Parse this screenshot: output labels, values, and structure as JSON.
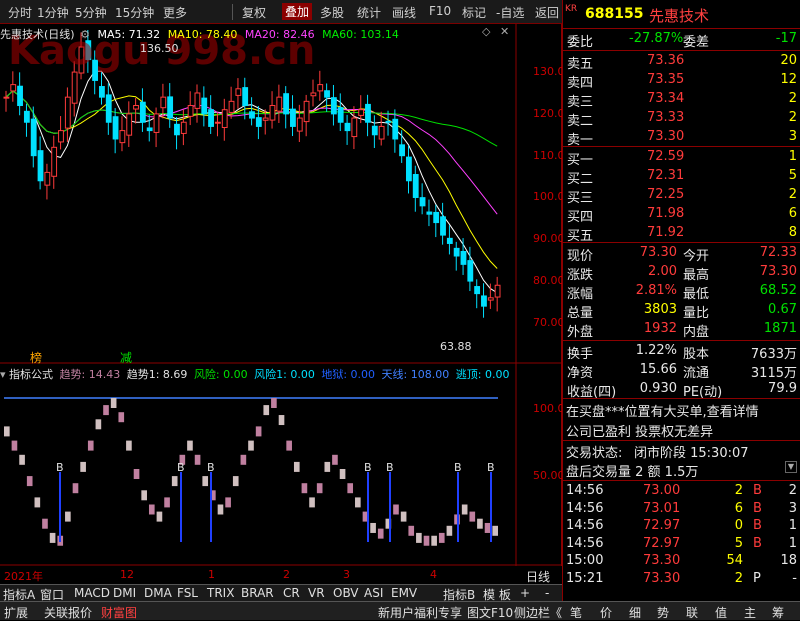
{
  "toolbar": {
    "items": [
      "分时",
      "1分钟",
      "5分钟",
      "15分钟",
      "更多",
      "复权",
      "叠加",
      "多股",
      "统计",
      "画线",
      "F10",
      "标记",
      "-自选",
      "返回"
    ]
  },
  "watermark": "Kaogu 998.cn",
  "main_chart": {
    "title": "先惠技术(日线)",
    "ma5_label": "MA5: 71.32",
    "ma10_label": "MA10: 78.40",
    "ma20_label": "MA20: 82.46",
    "ma60_label": "MA60: 103.14",
    "high_marker": "136.50",
    "low_marker": "63.88",
    "tag_bang": "榜",
    "tag_jian": "减",
    "y_ticks": [
      "130.0",
      "120.0",
      "110.0",
      "100.0",
      "90.00",
      "80.00",
      "70.00"
    ]
  },
  "indicator": {
    "name": "指标公式",
    "qushi": "趋势: 14.43",
    "qushi1": "趋势1: 8.69",
    "fengxian": "风险: 0.00",
    "fengxian1": "风险1: 0.00",
    "diyu": "地狱: 0.00",
    "tianxian": "天线: 108.00",
    "taoding": "逃顶: 0.00",
    "y_ticks": [
      "100.0",
      "50.00"
    ],
    "b_label": "B"
  },
  "x_axis": {
    "labels": [
      "2021年",
      "12",
      "1",
      "2",
      "3",
      "4"
    ],
    "period": "日线"
  },
  "tabs": [
    "指标A",
    "窗口",
    "MACD",
    "DMI",
    "DMA",
    "FSL",
    "TRIX",
    "BRAR",
    "CR",
    "VR",
    "OBV",
    "ASI",
    "EMV",
    "指标B",
    "模 板",
    "+",
    "-"
  ],
  "status": {
    "left": [
      "扩展",
      "关联报价",
      "财富图"
    ],
    "middle": [
      "新用户福利专享",
      "图文F10",
      "侧边栏《"
    ],
    "right": [
      "笔",
      "价",
      "细",
      "势",
      "联",
      "值",
      "主",
      "筹"
    ]
  },
  "quote": {
    "code_prefix": "KR",
    "code": "688155",
    "name": "先惠技术",
    "weibi_label": "委比",
    "weibi_value": "-27.87%",
    "weicha_label": "委差",
    "weicha_value": "-17",
    "asks": [
      {
        "label": "卖五",
        "price": "73.36",
        "vol": "20"
      },
      {
        "label": "卖四",
        "price": "73.35",
        "vol": "12"
      },
      {
        "label": "卖三",
        "price": "73.34",
        "vol": "2"
      },
      {
        "label": "卖二",
        "price": "73.33",
        "vol": "2"
      },
      {
        "label": "卖一",
        "price": "73.30",
        "vol": "3"
      }
    ],
    "bids": [
      {
        "label": "买一",
        "price": "72.59",
        "vol": "1"
      },
      {
        "label": "买二",
        "price": "72.31",
        "vol": "5"
      },
      {
        "label": "买三",
        "price": "72.25",
        "vol": "2"
      },
      {
        "label": "买四",
        "price": "71.98",
        "vol": "6"
      },
      {
        "label": "买五",
        "price": "71.92",
        "vol": "8"
      }
    ],
    "stats": [
      {
        "l1": "现价",
        "v1": "73.30",
        "l2": "今开",
        "v2": "72.33",
        "c1": "red",
        "c2": "red"
      },
      {
        "l1": "涨跌",
        "v1": "2.00",
        "l2": "最高",
        "v2": "73.30",
        "c1": "red",
        "c2": "red"
      },
      {
        "l1": "涨幅",
        "v1": "2.81%",
        "l2": "最低",
        "v2": "68.52",
        "c1": "red",
        "c2": "green"
      },
      {
        "l1": "总量",
        "v1": "3803",
        "l2": "量比",
        "v2": "0.67",
        "c1": "yellow",
        "c2": "green"
      },
      {
        "l1": "外盘",
        "v1": "1932",
        "l2": "内盘",
        "v2": "1871",
        "c1": "red",
        "c2": "green"
      }
    ],
    "stats2": [
      {
        "l1": "换手",
        "v1": "1.22%",
        "l2": "股本",
        "v2": "7633万"
      },
      {
        "l1": "净资",
        "v1": "15.66",
        "l2": "流通",
        "v2": "3115万"
      },
      {
        "l1": "收益(四)",
        "v1": "0.930",
        "l2": "PE(动)",
        "v2": "79.9"
      }
    ],
    "note1": "在买盘***位置有大买单,查看详情",
    "note2": "公司已盈利 投票权无差异",
    "trade_status_label": "交易状态:",
    "trade_status_value": "闭市阶段 15:30:07",
    "after_hours": "盘后交易量 2 额 1.5万",
    "ticks": [
      {
        "time": "14:56",
        "price": "73.00",
        "vol": "2",
        "side": "B",
        "n": "2"
      },
      {
        "time": "14:56",
        "price": "73.01",
        "vol": "6",
        "side": "B",
        "n": "3"
      },
      {
        "time": "14:56",
        "price": "72.97",
        "vol": "0",
        "side": "B",
        "n": "1"
      },
      {
        "time": "14:56",
        "price": "72.97",
        "vol": "5",
        "side": "B",
        "n": "1"
      },
      {
        "time": "15:00",
        "price": "73.30",
        "vol": "54",
        "side": "",
        "n": "18"
      },
      {
        "time": "15:21",
        "price": "73.30",
        "vol": "2",
        "side": "P",
        "n": "-"
      }
    ]
  },
  "colors": {
    "up": "#ff3b3b",
    "down": "#00e0ff",
    "ma5": "#ffffff",
    "ma10": "#ffff00",
    "ma20": "#ff40ff",
    "ma60": "#00e000"
  }
}
